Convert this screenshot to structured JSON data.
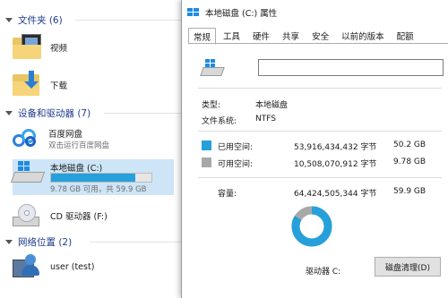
{
  "explorer": {
    "groups": {
      "folders": "文件夹 (6)",
      "devices": "设备和驱动器 (7)",
      "network": "网络位置 (2)"
    },
    "items": {
      "video": "视频",
      "downloads": "下载",
      "baidu_title": "百度网盘",
      "baidu_sub": "双击运行百度网盘",
      "local_disk": "本地磁盘 (C:)",
      "local_disk_space": "9.78 GB 可用，共 59.9 GB",
      "cd_drive": "CD 驱动器 (F:)",
      "user": "user (test)"
    },
    "local_disk_used_fraction": 0.837
  },
  "dialog": {
    "title": "本地磁盘 (C:) 属性",
    "tabs": [
      "常规",
      "工具",
      "硬件",
      "共享",
      "安全",
      "以前的版本",
      "配额"
    ],
    "name_value": "",
    "type_label": "类型:",
    "type_value": "本地磁盘",
    "fs_label": "文件系统:",
    "fs_value": "NTFS",
    "used_label": "已用空间:",
    "used_bytes": "53,916,434,432 字节",
    "used_gb": "50.2 GB",
    "free_label": "可用空间:",
    "free_bytes": "10,508,070,912 字节",
    "free_gb": "9.78 GB",
    "capacity_label": "容量:",
    "capacity_bytes": "64,424,505,344 字节",
    "capacity_gb": "59.9 GB",
    "drive_label": "驱动器 C:",
    "clean_button": "磁盘清理(D)",
    "colors": {
      "used": "#26a0da",
      "free": "#a8a8a8"
    },
    "used_fraction": 0.837
  }
}
